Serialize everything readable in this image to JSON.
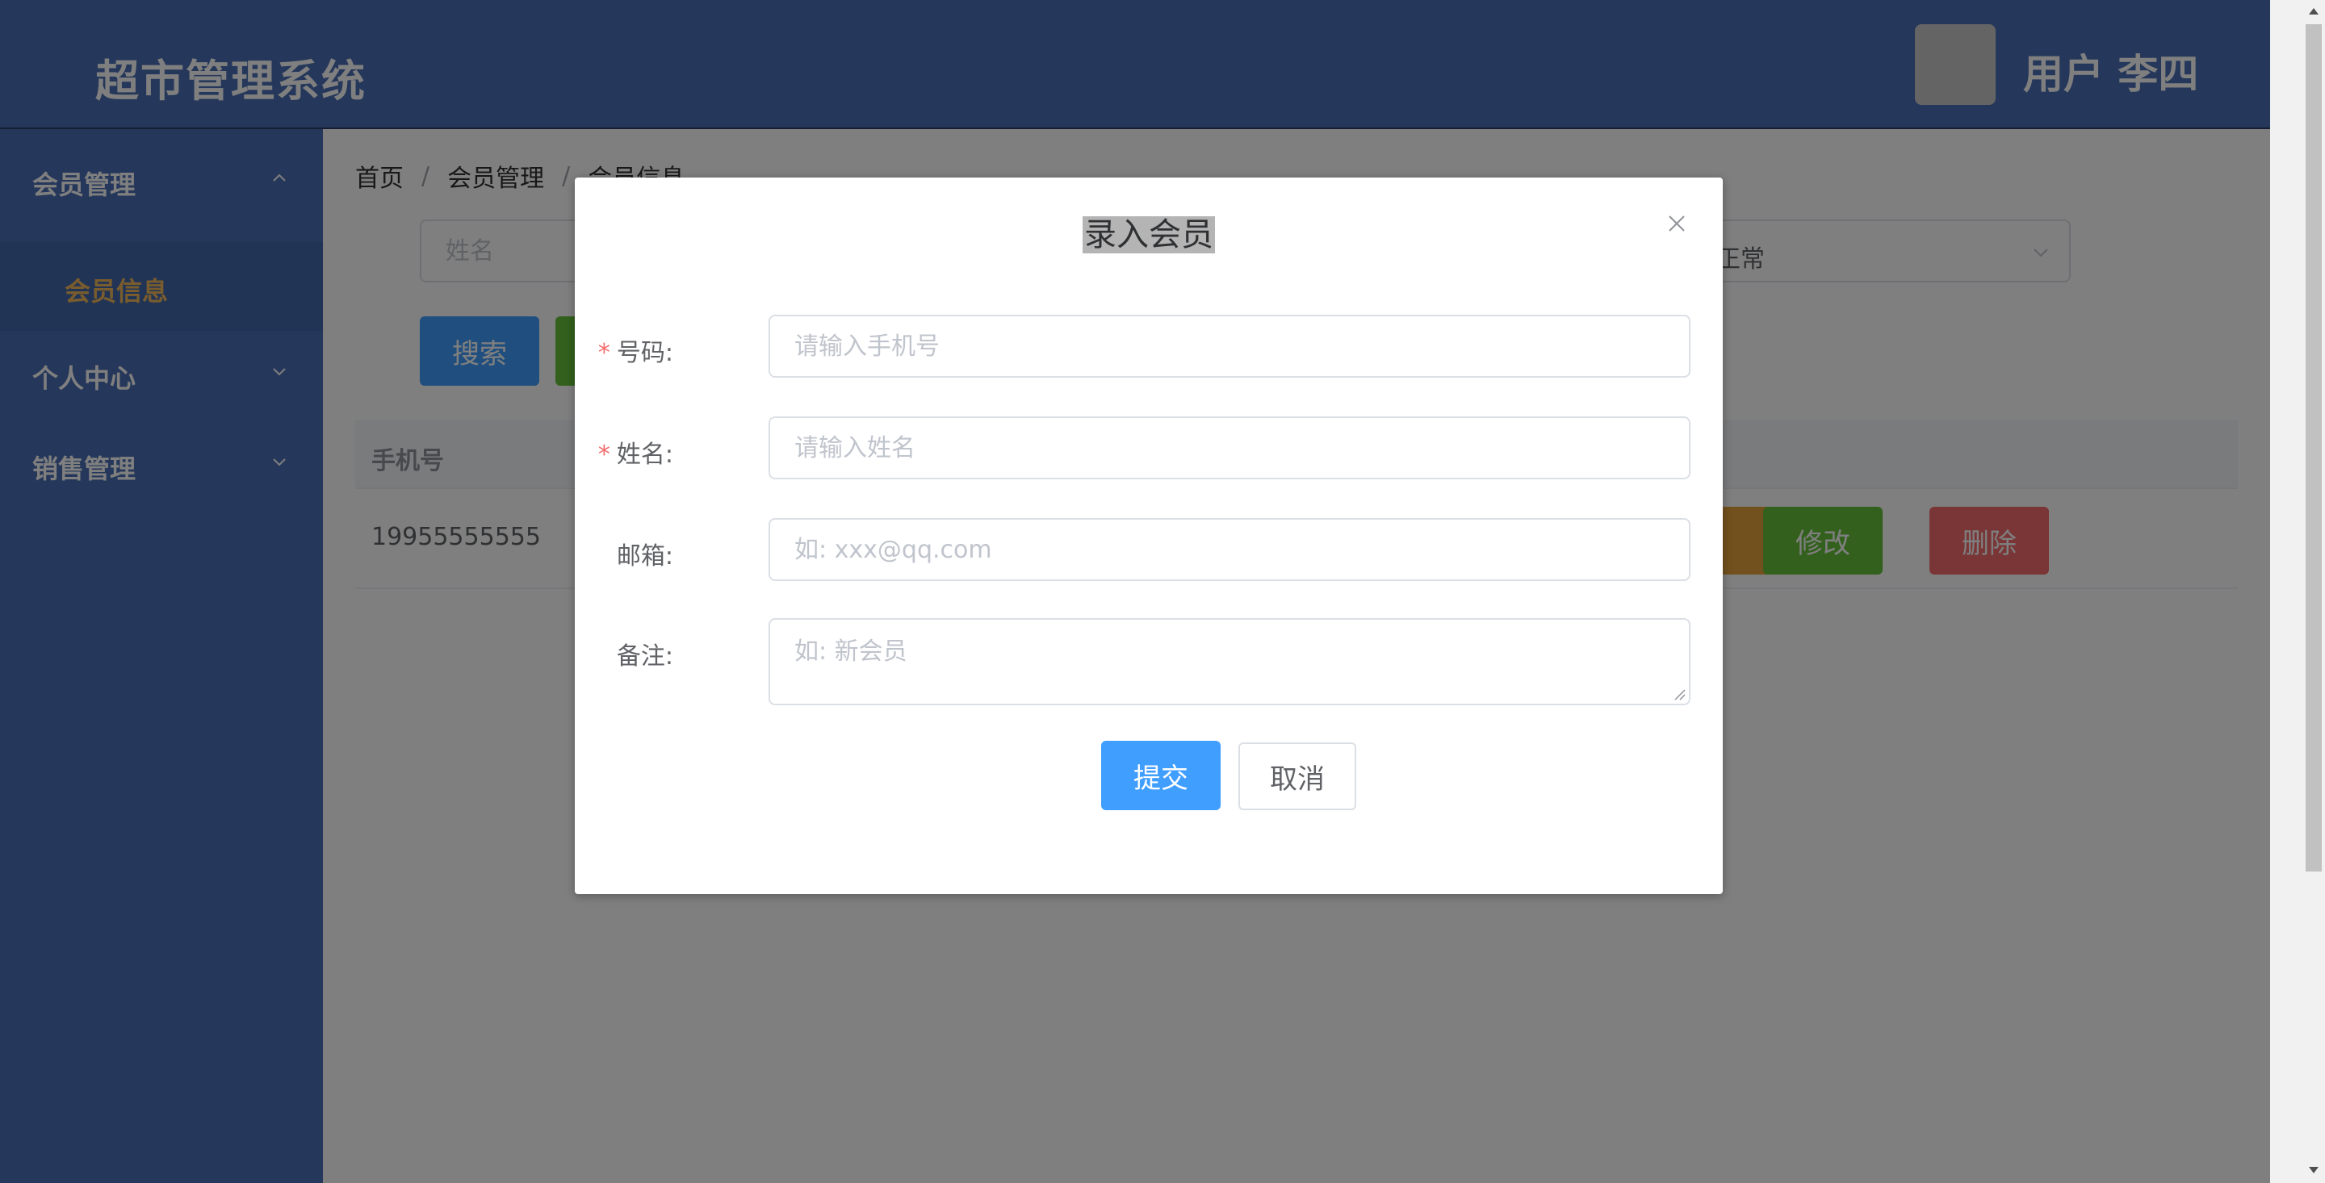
{
  "header": {
    "app_title": "超市管理系统",
    "user_label": "用户 李四"
  },
  "sidebar": {
    "items": [
      {
        "label": "会员管理",
        "expanded": true,
        "icon": "chevron-up-icon"
      },
      {
        "label": "个人中心",
        "expanded": false,
        "icon": "chevron-down-icon"
      },
      {
        "label": "销售管理",
        "expanded": false,
        "icon": "chevron-down-icon"
      }
    ],
    "active_submenu": "会员信息"
  },
  "breadcrumb": [
    "首页",
    "会员管理",
    "会员信息"
  ],
  "filters": {
    "name_placeholder": "姓名",
    "status_value": "正常"
  },
  "toolbar": {
    "search_label": "搜索"
  },
  "table": {
    "columns": [
      "手机号"
    ],
    "rows": [
      {
        "phone": "19955555555",
        "edit_label": "修改",
        "delete_label": "删除"
      }
    ]
  },
  "dialog": {
    "title": "录入会员",
    "fields": {
      "phone": {
        "label": "号码:",
        "required": true,
        "placeholder": "请输入手机号",
        "value": ""
      },
      "name": {
        "label": "姓名:",
        "required": true,
        "placeholder": "请输入姓名",
        "value": ""
      },
      "email": {
        "label": "邮箱:",
        "required": false,
        "placeholder": "如: xxx@qq.com",
        "value": ""
      },
      "remark": {
        "label": "备注:",
        "required": false,
        "placeholder": "如: 新会员",
        "value": ""
      }
    },
    "required_mark": "*",
    "submit_label": "提交",
    "cancel_label": "取消"
  },
  "colors": {
    "header_bg": "#4a6fb5",
    "primary": "#409eff",
    "success": "#67c23a",
    "warning": "#e6a23c",
    "danger": "#f56c6c",
    "active_menu_text": "#f0b95c"
  }
}
